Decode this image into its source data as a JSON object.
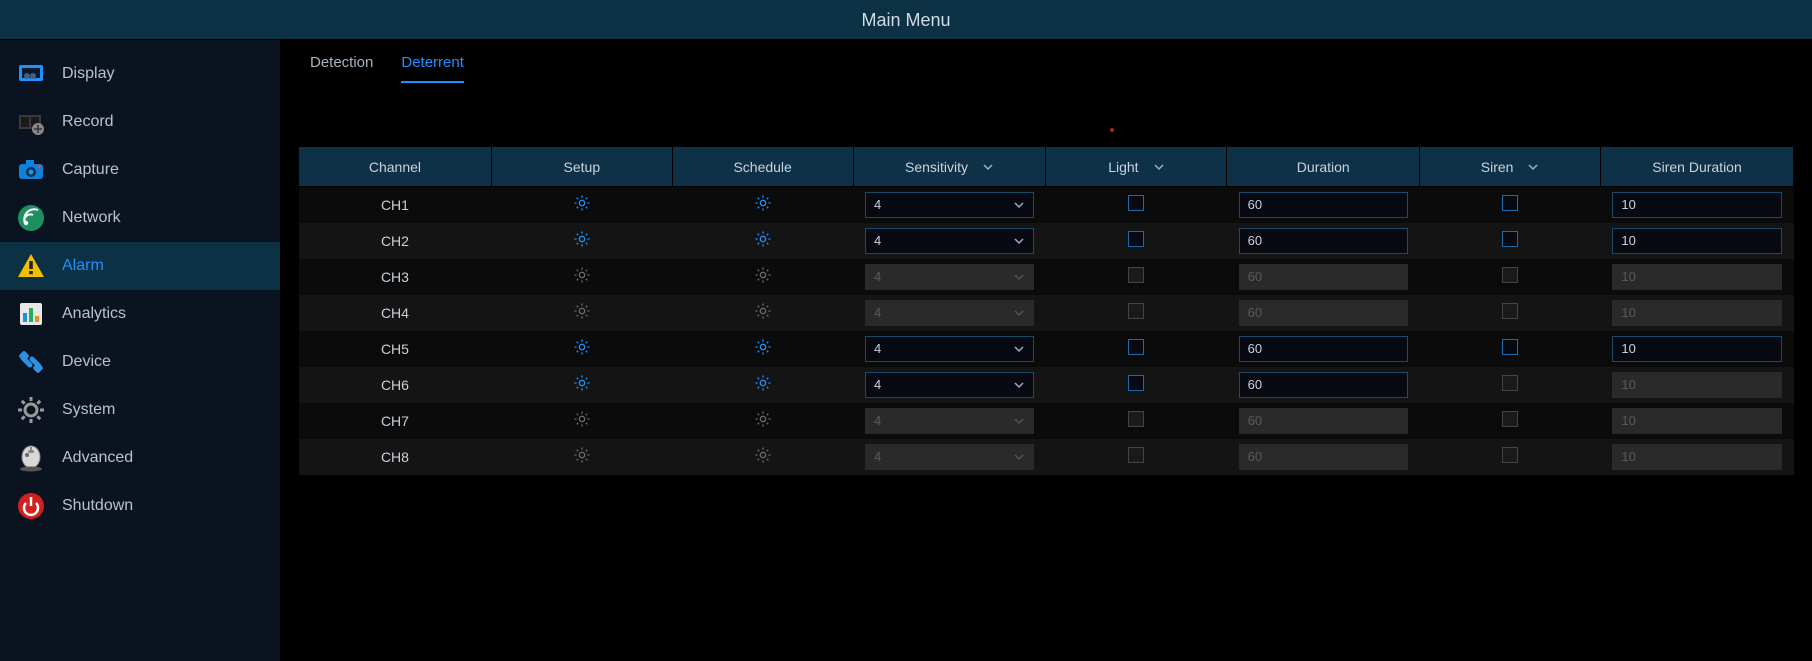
{
  "title": "Main Menu",
  "sidebar": {
    "items": [
      {
        "label": "Display",
        "icon": "display",
        "active": false
      },
      {
        "label": "Record",
        "icon": "record",
        "active": false
      },
      {
        "label": "Capture",
        "icon": "capture",
        "active": false
      },
      {
        "label": "Network",
        "icon": "network",
        "active": false
      },
      {
        "label": "Alarm",
        "icon": "alarm",
        "active": true
      },
      {
        "label": "Analytics",
        "icon": "analytics",
        "active": false
      },
      {
        "label": "Device",
        "icon": "device",
        "active": false
      },
      {
        "label": "System",
        "icon": "system",
        "active": false
      },
      {
        "label": "Advanced",
        "icon": "advanced",
        "active": false
      },
      {
        "label": "Shutdown",
        "icon": "shutdown",
        "active": false
      }
    ]
  },
  "tabs": [
    {
      "label": "Detection",
      "active": false
    },
    {
      "label": "Deterrent",
      "active": true
    }
  ],
  "columns": {
    "channel": "Channel",
    "setup": "Setup",
    "schedule": "Schedule",
    "sensitivity": "Sensitivity",
    "light": "Light",
    "duration": "Duration",
    "siren": "Siren",
    "sirenDuration": "Siren Duration"
  },
  "rows": [
    {
      "channel": "CH1",
      "enabled": true,
      "sensitivity": "4",
      "light": false,
      "duration": "60",
      "siren": false,
      "siren_enabled": true,
      "sirenDuration": "10",
      "sd_enabled": true
    },
    {
      "channel": "CH2",
      "enabled": true,
      "sensitivity": "4",
      "light": false,
      "duration": "60",
      "siren": false,
      "siren_enabled": true,
      "sirenDuration": "10",
      "sd_enabled": true
    },
    {
      "channel": "CH3",
      "enabled": false,
      "sensitivity": "4",
      "light": false,
      "duration": "60",
      "siren": false,
      "siren_enabled": false,
      "sirenDuration": "10",
      "sd_enabled": false
    },
    {
      "channel": "CH4",
      "enabled": false,
      "sensitivity": "4",
      "light": false,
      "duration": "60",
      "siren": false,
      "siren_enabled": false,
      "sirenDuration": "10",
      "sd_enabled": false
    },
    {
      "channel": "CH5",
      "enabled": true,
      "sensitivity": "4",
      "light": false,
      "duration": "60",
      "siren": false,
      "siren_enabled": true,
      "sirenDuration": "10",
      "sd_enabled": true
    },
    {
      "channel": "CH6",
      "enabled": true,
      "sensitivity": "4",
      "light": false,
      "duration": "60",
      "siren": false,
      "siren_enabled": false,
      "sirenDuration": "10",
      "sd_enabled": false
    },
    {
      "channel": "CH7",
      "enabled": false,
      "sensitivity": "4",
      "light": false,
      "duration": "60",
      "siren": false,
      "siren_enabled": false,
      "sirenDuration": "10",
      "sd_enabled": false
    },
    {
      "channel": "CH8",
      "enabled": false,
      "sensitivity": "4",
      "light": false,
      "duration": "60",
      "siren": false,
      "siren_enabled": false,
      "sirenDuration": "10",
      "sd_enabled": false
    }
  ]
}
